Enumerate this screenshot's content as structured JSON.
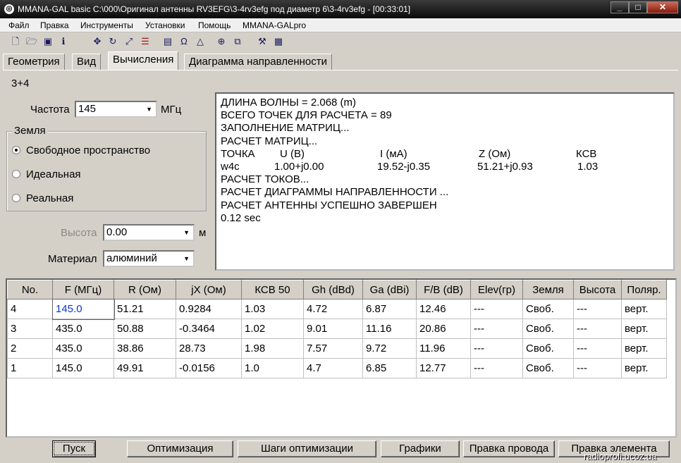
{
  "window": {
    "title": "MMANA-GAL basic C:\\000\\Оригинал антенны RV3EFG\\3-4rv3efg под диаметр 6\\3-4rv3efg - [00:33:01]",
    "min": "_",
    "max": "□",
    "close": "✕"
  },
  "menu": [
    "Файл",
    "Правка",
    "Инструменты",
    "Установки",
    "Помощь",
    "MMANA-GALpro"
  ],
  "toolbar_icons": [
    "new-icon",
    "open-icon",
    "save-icon",
    "info-icon",
    "move-icon",
    "rotate-icon",
    "resize-icon",
    "segments-icon",
    "document-icon",
    "wire-icon",
    "triangle-icon",
    "target-icon",
    "copy-icon",
    "tools-icon",
    "calculator-icon"
  ],
  "tabs": [
    "Геометрия",
    "Вид",
    "Вычисления",
    "Диаграмма направленности"
  ],
  "active_tab": "Вычисления",
  "antenna_name": "3+4",
  "frequency": {
    "label": "Частота",
    "value": "145",
    "unit": "МГц"
  },
  "ground": {
    "label": "Земля",
    "options": [
      "Свободное пространство",
      "Идеальная",
      "Реальная"
    ],
    "selected": "Свободное пространство"
  },
  "height": {
    "label": "Высота",
    "value": "0.00",
    "unit": "м"
  },
  "material": {
    "label": "Материал",
    "value": "алюминий"
  },
  "output": {
    "line1": "ДЛИНА ВОЛНЫ = 2.068 (m)",
    "line2": "ВСЕГО ТОЧЕК ДЛЯ РАСЧЕТА = 89",
    "line3": "ЗАПОЛНЕНИЕ МАТРИЦ...",
    "line4": "РАСЧЕТ МАТРИЦ...",
    "header": {
      "point": "ТОЧКА",
      "voltage": "U (В)",
      "current": "I (мА)",
      "impedance": "Z (Ом)",
      "swr": "КСВ"
    },
    "row": {
      "point": "w4c",
      "voltage": "1.00+j0.00",
      "current": "19.52-j0.35",
      "impedance": "51.21+j0.93",
      "swr": "1.03"
    },
    "line5": "РАСЧЕТ ТОКОВ...",
    "line6": "РАСЧЕТ ДИАГРАММЫ НАПРАВЛЕННОСТИ ...",
    "line7": "РАСЧЕТ АНТЕННЫ УСПЕШНО ЗАВЕРШЕН",
    "line8": "0.12 sec"
  },
  "table": {
    "headers": [
      "No.",
      "F (МГц)",
      "R (Ом)",
      "jX (Ом)",
      "КСВ 50",
      "Gh (dBd)",
      "Ga (dBi)",
      "F/B (dB)",
      "Elev(гр)",
      "Земля",
      "Высота",
      "Поляр."
    ],
    "rows": [
      [
        "4",
        "145.0",
        "51.21",
        "0.9284",
        "1.03",
        "4.72",
        "6.87",
        "12.46",
        "---",
        "Своб.",
        "---",
        "верт."
      ],
      [
        "3",
        "435.0",
        "50.88",
        "-0.3464",
        "1.02",
        "9.01",
        "11.16",
        "20.86",
        "---",
        "Своб.",
        "---",
        "верт."
      ],
      [
        "2",
        "435.0",
        "38.86",
        "28.73",
        "1.98",
        "7.57",
        "9.72",
        "11.96",
        "---",
        "Своб.",
        "---",
        "верт."
      ],
      [
        "1",
        "145.0",
        "49.91",
        "-0.0156",
        "1.0",
        "4.7",
        "6.85",
        "12.77",
        "---",
        "Своб.",
        "---",
        "верт."
      ]
    ]
  },
  "buttons": {
    "start": "Пуск",
    "optimize": "Оптимизация",
    "opt_steps": "Шаги оптимизации",
    "graphs": "Графики",
    "edit_wire": "Правка провода",
    "edit_element": "Правка элемента"
  },
  "watermark": "radioprofi.ucoz.ua"
}
